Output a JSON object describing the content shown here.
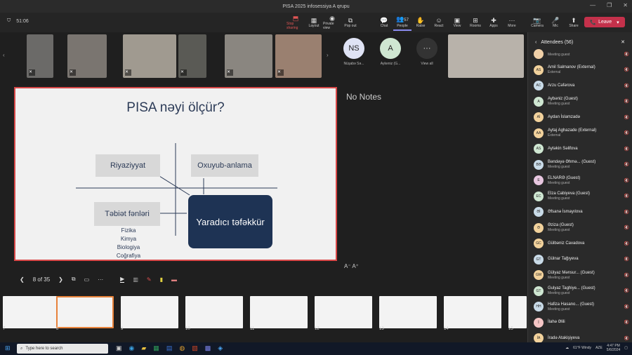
{
  "window": {
    "title": "PISA 2025 infosessiya A qrupu",
    "ctrl_min": "—",
    "ctrl_max": "❐",
    "ctrl_close": "✕"
  },
  "toolbar": {
    "timer": "51:06",
    "buttons": [
      {
        "label": "Stop sharing",
        "icon": "⬒"
      },
      {
        "label": "Layout",
        "icon": "▦"
      },
      {
        "label": "Private view",
        "icon": "◉"
      },
      {
        "label": "Pop out",
        "icon": "⧉"
      },
      {
        "label": "Chat",
        "icon": "💬"
      },
      {
        "label": "People",
        "icon": "👥",
        "count": "57"
      },
      {
        "label": "Raise",
        "icon": "✋"
      },
      {
        "label": "React",
        "icon": "☺"
      },
      {
        "label": "View",
        "icon": "▣"
      },
      {
        "label": "Rooms",
        "icon": "⊞"
      },
      {
        "label": "Apps",
        "icon": "✚"
      },
      {
        "label": "More",
        "icon": "···"
      },
      {
        "label": "Camera",
        "icon": "📷"
      },
      {
        "label": "Mic",
        "icon": "🎤"
      },
      {
        "label": "Share",
        "icon": "⬆"
      }
    ],
    "leave_label": "Leave",
    "leave_icon": "📞"
  },
  "participants": {
    "avatars": [
      {
        "initials": "NS",
        "name": "Nüşabə Sə...",
        "color": "#dfe3f5"
      },
      {
        "initials": "A",
        "name": "Aykeniz (G...",
        "color": "#cfe7d2"
      },
      {
        "initials": "···",
        "name": "View all",
        "color": "#333333"
      }
    ]
  },
  "slide": {
    "title": "PISA nəyi ölçür?",
    "box1": "Riyaziyyat",
    "box2": "Oxuyub-anlama",
    "box3": "Təbiət fənləri",
    "box4": "Yaradıcı təfəkkür",
    "subjects": [
      "Fizika",
      "Kimya",
      "Biologiya",
      "Coğrafiya"
    ]
  },
  "notes": "No Notes",
  "font_controls": "A⁻  A⁺",
  "nav": {
    "prev": "❮",
    "page": "8 of 35",
    "next": "❯"
  },
  "thumbnails": [
    "7",
    "8",
    "9",
    "10",
    "11",
    "12",
    "13",
    "14",
    "15"
  ],
  "attendees_panel": {
    "title": "Attendees (56)",
    "list": [
      {
        "initials": "",
        "name": "",
        "role": "Meeting guest",
        "color": "#f0d0a8"
      },
      {
        "initials": "AS",
        "name": "Amil Salmanov (External)",
        "role": "External",
        "color": "#f2d29c"
      },
      {
        "initials": "AC",
        "name": "Arzu Cəfərova",
        "role": "",
        "color": "#c9dbe8"
      },
      {
        "initials": "A",
        "name": "Aybəniz (Guest)",
        "role": "Meeting guest",
        "color": "#cfe7d2"
      },
      {
        "initials": "Aİ",
        "name": "Aydan İslamzadə",
        "role": "",
        "color": "#f2d29c"
      },
      {
        "initials": "AA",
        "name": "Aytaj Aghazade (External)",
        "role": "External",
        "color": "#f2d29c"
      },
      {
        "initials": "AS",
        "name": "Aytəkin Səlifova",
        "role": "",
        "color": "#cfe7d2"
      },
      {
        "initials": "BƏ",
        "name": "Bəndəyə Əhmə... (Guest)",
        "role": "Meeting guest",
        "color": "#c9dbe8"
      },
      {
        "initials": "E",
        "name": "ELNARƏ (Guest)",
        "role": "Meeting guest",
        "color": "#e8c7e0"
      },
      {
        "initials": "EC",
        "name": "Elza Cabiyeva (Guest)",
        "role": "Meeting guest",
        "color": "#cfe7d2"
      },
      {
        "initials": "Əİ",
        "name": "Əfsanə İsmayılova",
        "role": "",
        "color": "#c9dbe8"
      },
      {
        "initials": "Ə",
        "name": "Əziza (Guest)",
        "role": "Meeting guest",
        "color": "#f2d29c"
      },
      {
        "initials": "GC",
        "name": "Gülbəniz Cavadova",
        "role": "",
        "color": "#f2d29c"
      },
      {
        "initials": "GT",
        "name": "Gülnar Tağıyeva",
        "role": "",
        "color": "#c9dbe8"
      },
      {
        "initials": "GM",
        "name": "Gülyaz Mənsur... (Guest)",
        "role": "Meeting guest",
        "color": "#f2d29c"
      },
      {
        "initials": "GT",
        "name": "Gulyaz Taghiye... (Guest)",
        "role": "Meeting guest",
        "color": "#cfe7d2"
      },
      {
        "initials": "HH",
        "name": "Hafiza Hasano... (Guest)",
        "role": "Meeting guest",
        "color": "#c9dbe8"
      },
      {
        "initials": "İ",
        "name": "İlahə Əlili",
        "role": "",
        "color": "#f5c6c6"
      },
      {
        "initials": "İA",
        "name": "İradə Atakişiyeva",
        "role": "",
        "color": "#f2d29c"
      }
    ]
  },
  "taskbar": {
    "search_placeholder": "Type here to search",
    "weather": "61°F Windy",
    "lang": "AZE",
    "time": "4:47 PM",
    "date": "5/6/2024"
  }
}
